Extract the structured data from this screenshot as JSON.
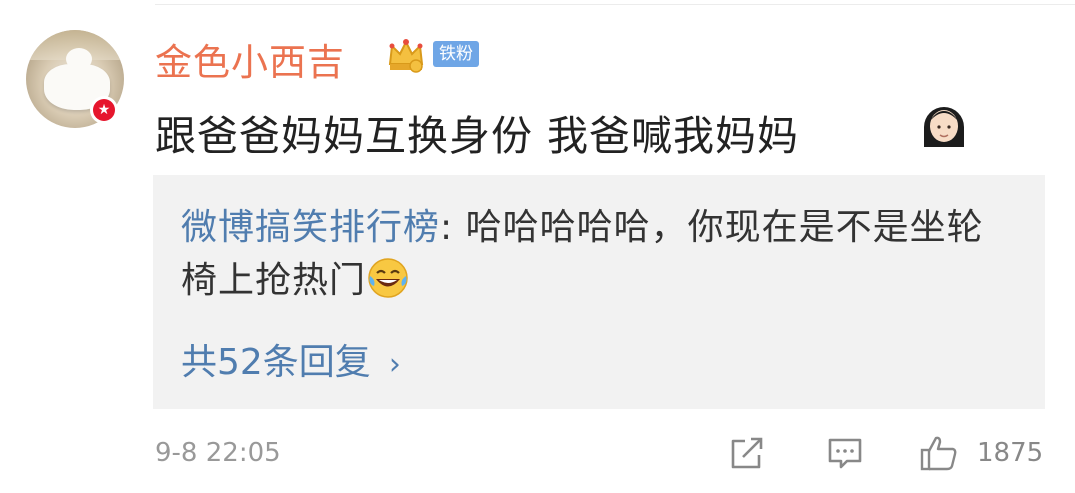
{
  "comment": {
    "username": "金色小西吉",
    "fan_badge": "铁粉",
    "text": "跟爸爸妈妈互换身份 我爸喊我妈妈",
    "timestamp": "9-8 22:05",
    "like_count": "1875"
  },
  "reply": {
    "author": "微博搞笑排行榜",
    "separator": ": ",
    "text": "哈哈哈哈哈，你现在是不是坐轮椅上抢热门",
    "count_label": "共52条回复",
    "chevron": "›"
  },
  "icons": {
    "verified": "★",
    "crown": "crown-icon",
    "emoji_in_comment": "woman-emoji",
    "emoji_in_reply": "laughing-tears-emoji"
  },
  "colors": {
    "username": "#eb7350",
    "link": "#507daf",
    "badge": "#6fa6e6",
    "verified": "#e6162d"
  }
}
